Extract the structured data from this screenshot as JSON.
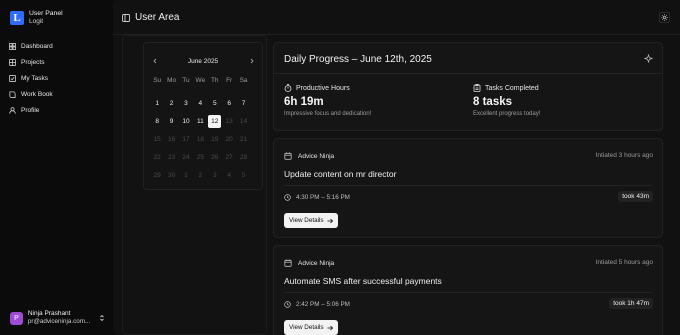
{
  "brand": {
    "title": "User Panel",
    "subtitle": "Logit",
    "logo_letter": "L"
  },
  "nav": [
    {
      "label": "Dashboard",
      "icon": "dashboard-icon"
    },
    {
      "label": "Projects",
      "icon": "projects-icon"
    },
    {
      "label": "My Tasks",
      "icon": "tasks-icon"
    },
    {
      "label": "Work Book",
      "icon": "book-icon"
    },
    {
      "label": "Profile",
      "icon": "user-icon"
    }
  ],
  "user": {
    "name": "Ninja Prashant",
    "email": "pr@adviceninja.com...",
    "avatar_letter": "P",
    "avatar_color": "#a04bd6"
  },
  "header": {
    "title": "User Area"
  },
  "calendar": {
    "month": "June 2025",
    "weekdays": [
      "Su",
      "Mo",
      "Tu",
      "We",
      "Th",
      "Fr",
      "Sa"
    ],
    "days": [
      {
        "n": "1",
        "s": "active"
      },
      {
        "n": "2",
        "s": "active"
      },
      {
        "n": "3",
        "s": "active"
      },
      {
        "n": "4",
        "s": "active"
      },
      {
        "n": "5",
        "s": "active"
      },
      {
        "n": "6",
        "s": "active"
      },
      {
        "n": "7",
        "s": "active"
      },
      {
        "n": "8",
        "s": "active"
      },
      {
        "n": "9",
        "s": "active"
      },
      {
        "n": "10",
        "s": "active"
      },
      {
        "n": "11",
        "s": "active"
      },
      {
        "n": "12",
        "s": "selected"
      },
      {
        "n": "13",
        "s": "muted"
      },
      {
        "n": "14",
        "s": "muted"
      },
      {
        "n": "15",
        "s": "muted"
      },
      {
        "n": "16",
        "s": "muted"
      },
      {
        "n": "17",
        "s": "muted"
      },
      {
        "n": "18",
        "s": "muted"
      },
      {
        "n": "19",
        "s": "muted"
      },
      {
        "n": "20",
        "s": "muted"
      },
      {
        "n": "21",
        "s": "muted"
      },
      {
        "n": "22",
        "s": "muted"
      },
      {
        "n": "23",
        "s": "muted"
      },
      {
        "n": "24",
        "s": "muted"
      },
      {
        "n": "25",
        "s": "muted"
      },
      {
        "n": "26",
        "s": "muted"
      },
      {
        "n": "27",
        "s": "muted"
      },
      {
        "n": "28",
        "s": "muted"
      },
      {
        "n": "29",
        "s": "muted"
      },
      {
        "n": "30",
        "s": "muted"
      },
      {
        "n": "1",
        "s": "muted"
      },
      {
        "n": "2",
        "s": "muted"
      },
      {
        "n": "3",
        "s": "muted"
      },
      {
        "n": "4",
        "s": "muted"
      },
      {
        "n": "5",
        "s": "muted"
      }
    ]
  },
  "progress": {
    "title": "Daily Progress – June 12th, 2025",
    "hours": {
      "label": "Productive Hours",
      "value": "6h 19m",
      "sub": "Impressive focus and dedication!"
    },
    "tasks": {
      "label": "Tasks Completed",
      "value": "8 tasks",
      "sub": "Excellent progress today!"
    }
  },
  "tasks": [
    {
      "source": "Advice Ninja",
      "ago": "Intiated 3 hours ago",
      "title": "Update content on mr director",
      "range": "4:30 PM – 5:16 PM",
      "took": "took 43m",
      "button": "View Details"
    },
    {
      "source": "Advice Ninja",
      "ago": "Intiated 5 hours ago",
      "title": "Automate SMS after successful payments",
      "range": "2:42 PM – 5:06 PM",
      "took": "took 1h 47m",
      "button": "View Details"
    }
  ]
}
